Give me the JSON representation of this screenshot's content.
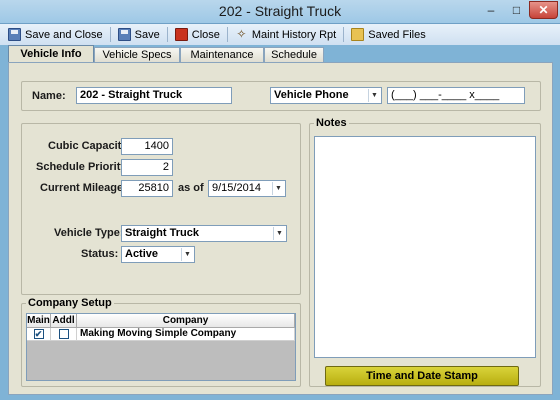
{
  "window": {
    "title": "202 - Straight Truck",
    "close_glyph": "✕",
    "min_glyph": "–",
    "max_glyph": "□"
  },
  "toolbar": [
    {
      "label": "Save and Close",
      "icon": "save-icon"
    },
    {
      "label": "Save",
      "icon": "save-icon"
    },
    {
      "label": "Close",
      "icon": "close-icon"
    },
    {
      "label": "Maint History Rpt",
      "icon": "wrench-icon"
    },
    {
      "label": "Saved Files",
      "icon": "folder-icon"
    }
  ],
  "tabs": [
    {
      "label": "Vehicle Info",
      "active": true
    },
    {
      "label": "Vehicle Specs",
      "active": false
    },
    {
      "label": "Maintenance",
      "active": false
    },
    {
      "label": "Schedule",
      "active": false
    }
  ],
  "name_section": {
    "name_label": "Name:",
    "name_value": "202 - Straight Truck",
    "phone_type": "Vehicle Phone",
    "phone_value": "(___) ___-____ x____"
  },
  "details": {
    "cubic_label": "Cubic Capacity:",
    "cubic_value": "1400",
    "priority_label": "Schedule Priority:",
    "priority_value": "2",
    "mileage_label": "Current Mileage:",
    "mileage_value": "25810",
    "as_of_label": "as of",
    "as_of_date": "9/15/2014",
    "type_label": "Vehicle Type:",
    "type_value": "Straight Truck",
    "status_label": "Status:",
    "status_value": "Active"
  },
  "company_setup": {
    "legend": "Company Setup",
    "columns": [
      "Main",
      "Addl",
      "Company"
    ],
    "rows": [
      {
        "main": true,
        "addl": false,
        "company": "Making Moving Simple Company"
      }
    ]
  },
  "notes": {
    "legend": "Notes"
  },
  "stamp_button": "Time and Date Stamp"
}
